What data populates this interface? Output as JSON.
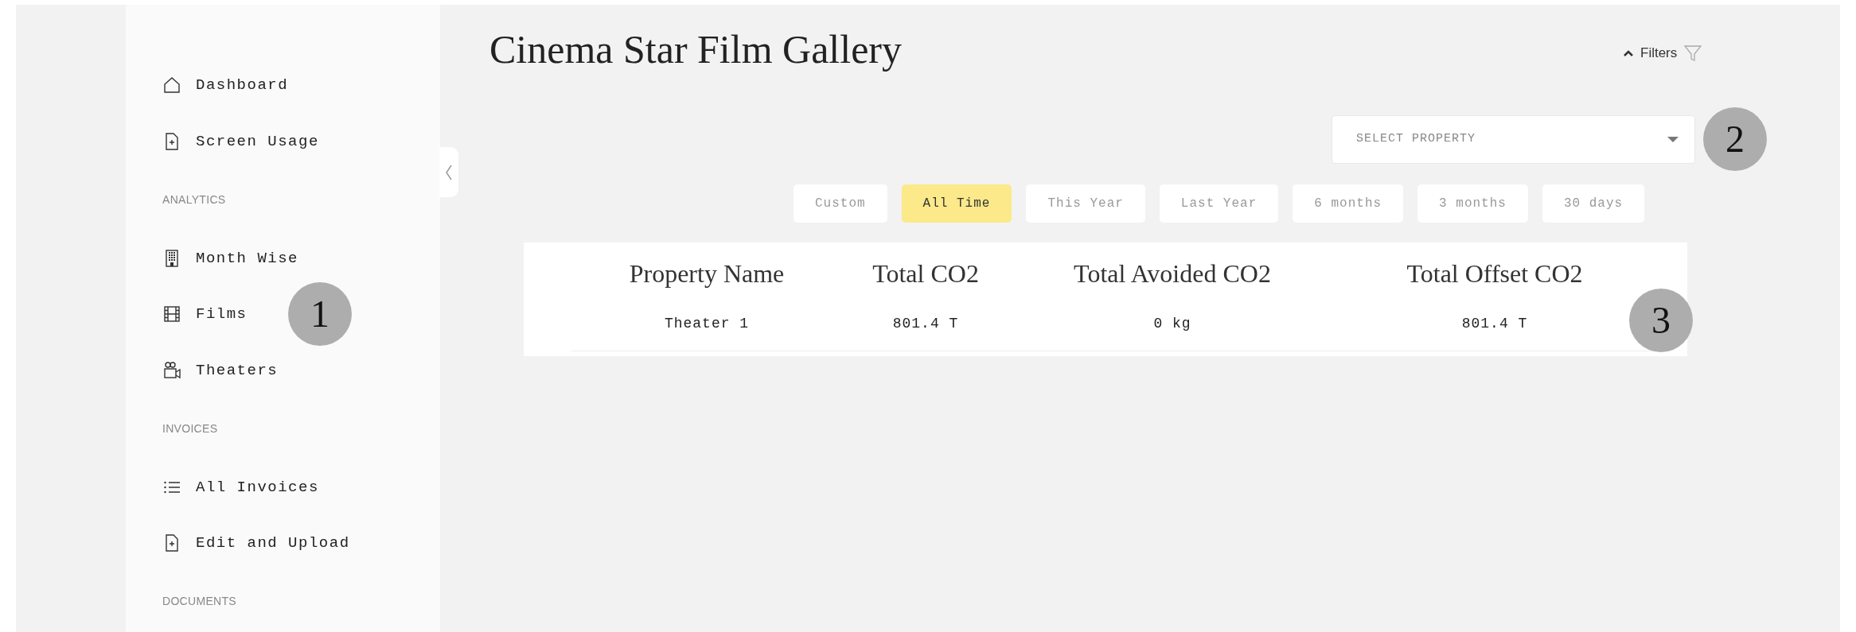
{
  "sidebar": {
    "items": [
      {
        "kind": "link",
        "label": "Dashboard"
      },
      {
        "kind": "link",
        "label": "Screen Usage"
      },
      {
        "kind": "section",
        "label": "ANALYTICS"
      },
      {
        "kind": "link",
        "label": "Month Wise"
      },
      {
        "kind": "link",
        "label": "Films"
      },
      {
        "kind": "link",
        "label": "Theaters"
      },
      {
        "kind": "section",
        "label": "INVOICES"
      },
      {
        "kind": "link",
        "label": "All Invoices"
      },
      {
        "kind": "link",
        "label": "Edit and Upload"
      },
      {
        "kind": "section",
        "label": "DOCUMENTS"
      }
    ]
  },
  "page": {
    "title": "Cinema Star Film Gallery"
  },
  "filters": {
    "label": "Filters",
    "expanded": true
  },
  "property_select": {
    "placeholder": "SELECT PROPERTY"
  },
  "date_ranges": [
    {
      "label": "Custom",
      "selected": false
    },
    {
      "label": "All Time",
      "selected": true
    },
    {
      "label": "This Year",
      "selected": false
    },
    {
      "label": "Last Year",
      "selected": false
    },
    {
      "label": "6 months",
      "selected": false
    },
    {
      "label": "3 months",
      "selected": false
    },
    {
      "label": "30 days",
      "selected": false
    }
  ],
  "table": {
    "columns": [
      "Property Name",
      "Total CO2",
      "Total Avoided CO2",
      "Total Offset CO2"
    ],
    "rows": [
      [
        "Theater 1",
        "801.4 T",
        "0 kg",
        "801.4 T"
      ]
    ]
  },
  "callouts": [
    {
      "label": "1"
    },
    {
      "label": "2"
    },
    {
      "label": "3"
    }
  ]
}
